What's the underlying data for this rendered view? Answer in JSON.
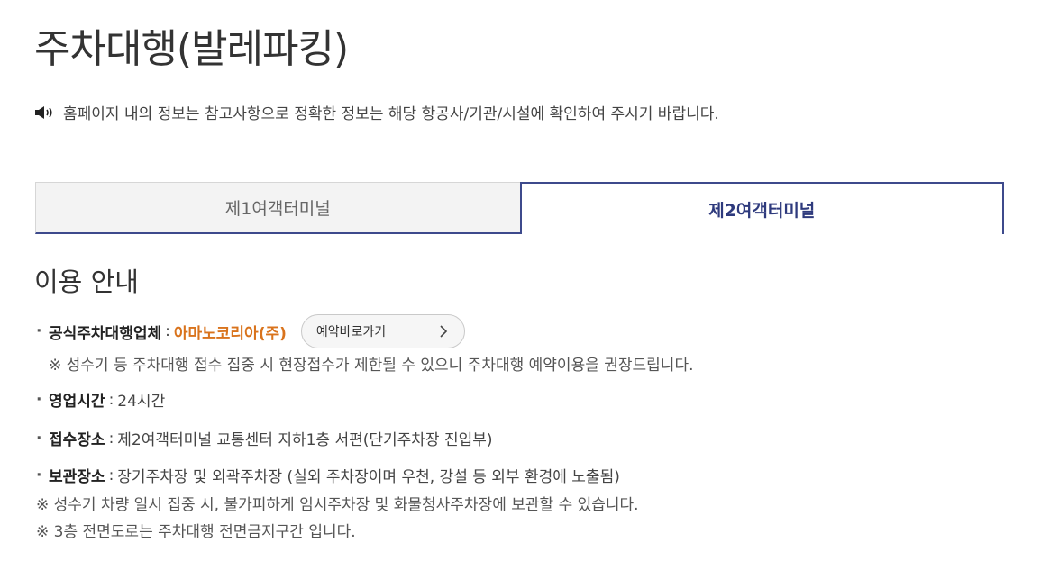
{
  "page": {
    "title": "주차대행(발레파킹)",
    "notice": "홈페이지 내의 정보는 참고사항으로 정확한 정보는 해당 항공사/기관/시설에 확인하여 주시기 바랍니다."
  },
  "tabs": [
    {
      "label": "제1여객터미널",
      "active": false
    },
    {
      "label": "제2여객터미널",
      "active": true
    }
  ],
  "section": {
    "title": "이용 안내"
  },
  "info": {
    "vendor": {
      "label": "공식주차대행업체",
      "value": "아마노코리아(주)",
      "button_label": "예약바로가기",
      "note": "※ 성수기 등 주차대행 접수 집중 시 현장접수가 제한될 수 있으니 주차대행 예약이용을 권장드립니다."
    },
    "hours": {
      "label": "영업시간",
      "value": "24시간"
    },
    "reception": {
      "label": "접수장소",
      "value": "제2여객터미널 교통센터 지하1층 서편(단기주차장 진입부)"
    },
    "storage": {
      "label": "보관장소",
      "value": "장기주차장 및 외곽주차장 (실외 주차장이며 우천, 강설 등 외부 환경에 노출됨)",
      "note1": "※ 성수기 차량 일시 집중 시, 불가피하게 임시주차장 및 화물청사주차장에 보관할 수 있습니다.",
      "note2": "※ 3층 전면도로는 주차대행 전면금지구간 입니다."
    }
  },
  "colors": {
    "accent": "#3d4a8c",
    "vendor": "#d9731c"
  }
}
